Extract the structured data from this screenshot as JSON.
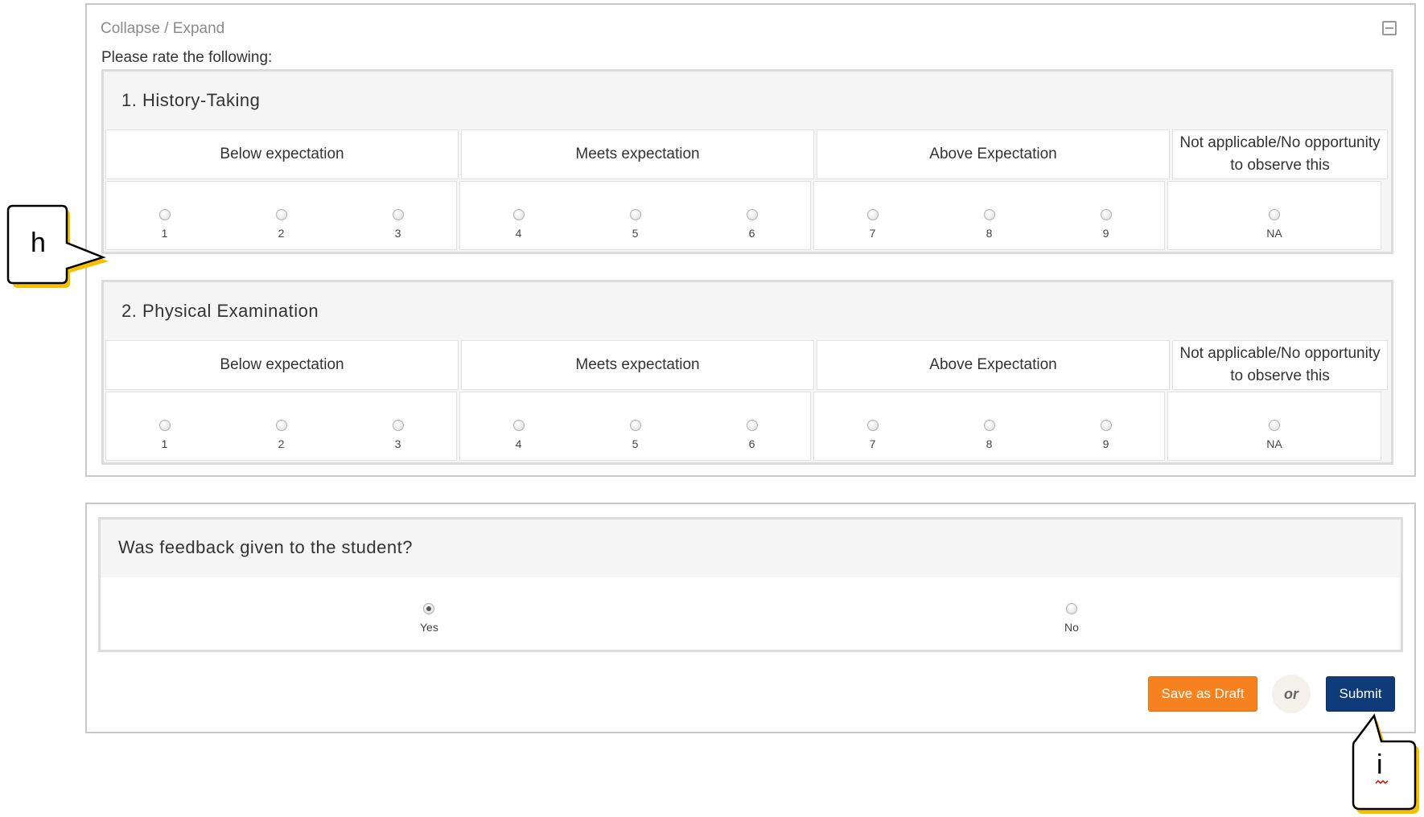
{
  "panel": {
    "collapse_label": "Collapse / Expand",
    "collapse_icon": "collapse-icon",
    "prompt": "Please rate the following:"
  },
  "questions": [
    {
      "title": "1. History-Taking",
      "headers": [
        "Below expectation",
        "Meets expectation",
        "Above Expectation",
        "Not applicable/No opportunity to observe this"
      ],
      "options": [
        "1",
        "2",
        "3",
        "4",
        "5",
        "6",
        "7",
        "8",
        "9",
        "NA"
      ]
    },
    {
      "title": "2. Physical Examination",
      "headers": [
        "Below expectation",
        "Meets expectation",
        "Above Expectation",
        "Not applicable/No opportunity to observe this"
      ],
      "options": [
        "1",
        "2",
        "3",
        "4",
        "5",
        "6",
        "7",
        "8",
        "9",
        "NA"
      ]
    }
  ],
  "feedback": {
    "title": "Was feedback given to the student?",
    "options": [
      "Yes",
      "No"
    ],
    "selected": "Yes"
  },
  "actions": {
    "save_draft": "Save as Draft",
    "or": "or",
    "submit": "Submit"
  },
  "callouts": {
    "h": "h",
    "i": "i"
  },
  "colors": {
    "draft_button": "#f5821f",
    "submit_button": "#0f3c78",
    "callout_shadow": "#f5c000"
  }
}
